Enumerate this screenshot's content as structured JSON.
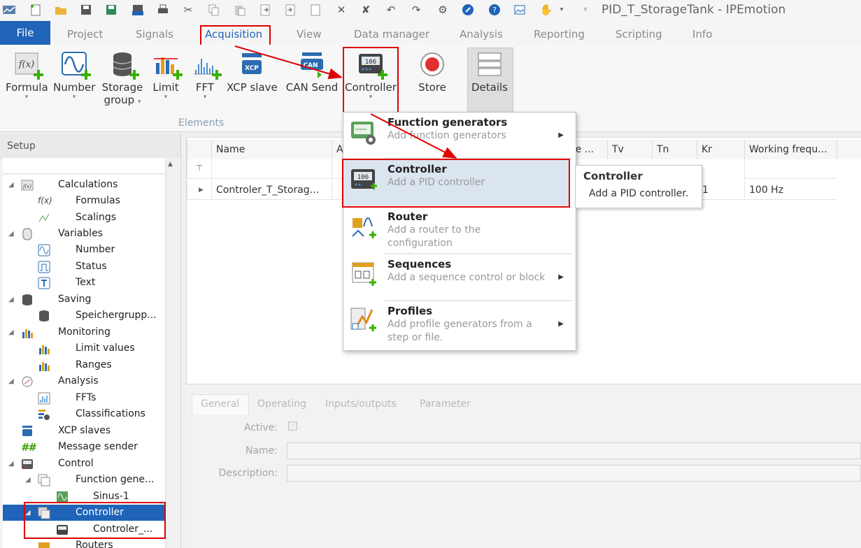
{
  "window": {
    "title": "PID_T_StorageTank - IPEmotion"
  },
  "ribbon_tabs": {
    "file": "File",
    "project": "Project",
    "signals": "Signals",
    "acquisition": "Acquisition",
    "view": "View",
    "data_manager": "Data manager",
    "analysis": "Analysis",
    "reporting": "Reporting",
    "scripting": "Scripting",
    "info": "Info"
  },
  "ribbon": {
    "formula": "Formula",
    "number": "Number",
    "storage_group_1": "Storage",
    "storage_group_2": "group",
    "limit": "Limit",
    "fft": "FFT",
    "xcp_slave": "XCP slave",
    "can_send": "CAN Send",
    "controller": "Controller",
    "store": "Store",
    "details": "Details",
    "elements_group": "Elements",
    "controller_icon_text": "106",
    "xcp_icon_text": "XCP",
    "can_icon_text": "CAN"
  },
  "setup": {
    "title": "Setup",
    "tree": {
      "calculations": "Calculations",
      "formulas": "Formulas",
      "scalings": "Scalings",
      "variables": "Variables",
      "number": "Number",
      "status": "Status",
      "text": "Text",
      "saving": "Saving",
      "speichergruppe": "Speichergrupp...",
      "monitoring": "Monitoring",
      "limit_values": "Limit values",
      "ranges": "Ranges",
      "analysis": "Analysis",
      "ffts": "FFTs",
      "classifications": "Classifications",
      "xcp_slaves": "XCP slaves",
      "message_sender": "Message sender",
      "control": "Control",
      "function_gene": "Function gene...",
      "sinus1": "Sinus-1",
      "controller": "Controller",
      "controler_item": "Controler_...",
      "routers": "Routers"
    }
  },
  "grid": {
    "columns": {
      "name": "Name",
      "a": "A",
      "ce": "ce ...",
      "tv": "Tv",
      "tn": "Tn",
      "kr": "Kr",
      "working_freq": "Working frequ..."
    },
    "row": {
      "name": "Controler_T_Storag...",
      "kr": "1",
      "working_freq": "100 Hz"
    }
  },
  "props": {
    "tabs": {
      "general": "General",
      "operating": "Operating",
      "inputs_outputs": "Inputs/outputs",
      "parameter": "Parameter"
    },
    "active_label": "Active:",
    "name_label": "Name:",
    "description_label": "Description:"
  },
  "menu": {
    "function_generators": {
      "title": "Function generators",
      "desc": "Add function generators"
    },
    "controller": {
      "title": "Controller",
      "desc": "Add a PID controller"
    },
    "router": {
      "title": "Router",
      "desc1": "Add a router to the",
      "desc2": "configuration"
    },
    "sequences": {
      "title": "Sequences",
      "desc": "Add a sequence control or block"
    },
    "profiles": {
      "title": "Profiles",
      "desc1": "Add profile generators from a",
      "desc2": "step or file."
    }
  },
  "tooltip": {
    "title": "Controller",
    "desc": "Add a PID controller."
  },
  "colors": {
    "accent": "#1f64b8",
    "highlight": "#e00000",
    "plus": "#38b000"
  }
}
